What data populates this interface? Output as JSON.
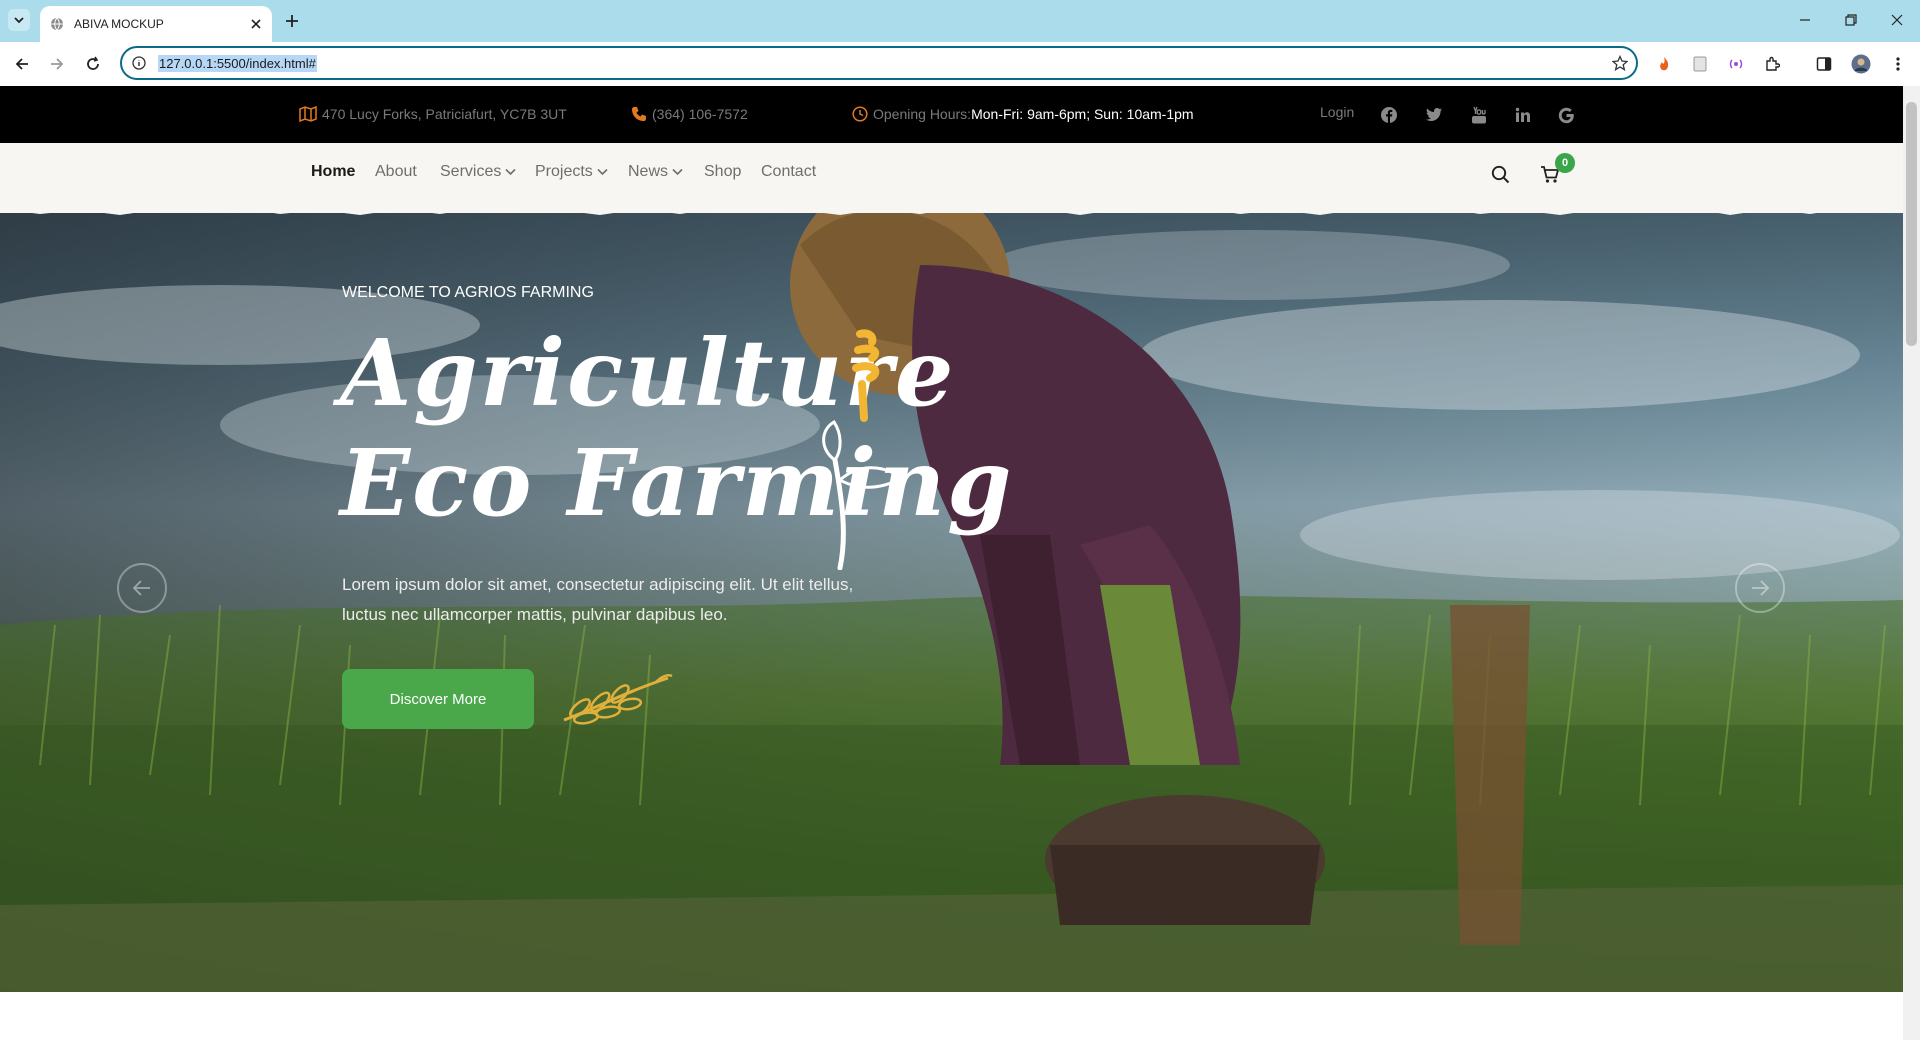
{
  "browser": {
    "tab_title": "ABIVA MOCKUP",
    "url": "127.0.0.1:5500/index.html#"
  },
  "topbar": {
    "address": "470 Lucy Forks, Patriciafurt, YC7B 3UT",
    "phone": "(364) 106-7572",
    "hours_label": "Opening Hours:",
    "hours_value": "Mon-Fri: 9am-6pm; Sun: 10am-1pm",
    "login": "Login",
    "social_icons": [
      "facebook-icon",
      "twitter-icon",
      "youtube-icon",
      "linkedin-icon",
      "google-icon"
    ]
  },
  "nav": {
    "items": [
      {
        "label": "Home",
        "active": true
      },
      {
        "label": "About"
      },
      {
        "label": "Services",
        "dropdown": true
      },
      {
        "label": "Projects",
        "dropdown": true
      },
      {
        "label": "News",
        "dropdown": true
      },
      {
        "label": "Shop"
      },
      {
        "label": "Contact"
      }
    ],
    "cart_count": "0"
  },
  "hero": {
    "subtitle": "WELCOME TO AGRIOS FARMING",
    "title_line1": "Agriculture",
    "title_line2": "Eco Farming",
    "description": "Lorem ipsum dolor sit amet, consectetur adipiscing elit. Ut elit tellus, luctus nec ullamcorper mattis, pulvinar dapibus leo.",
    "button_label": "Discover More"
  },
  "colors": {
    "accent_green": "#4aa74a",
    "accent_yellow": "#f2b632",
    "topbar_bg": "#000000",
    "nav_bg": "#f7f6f2"
  }
}
